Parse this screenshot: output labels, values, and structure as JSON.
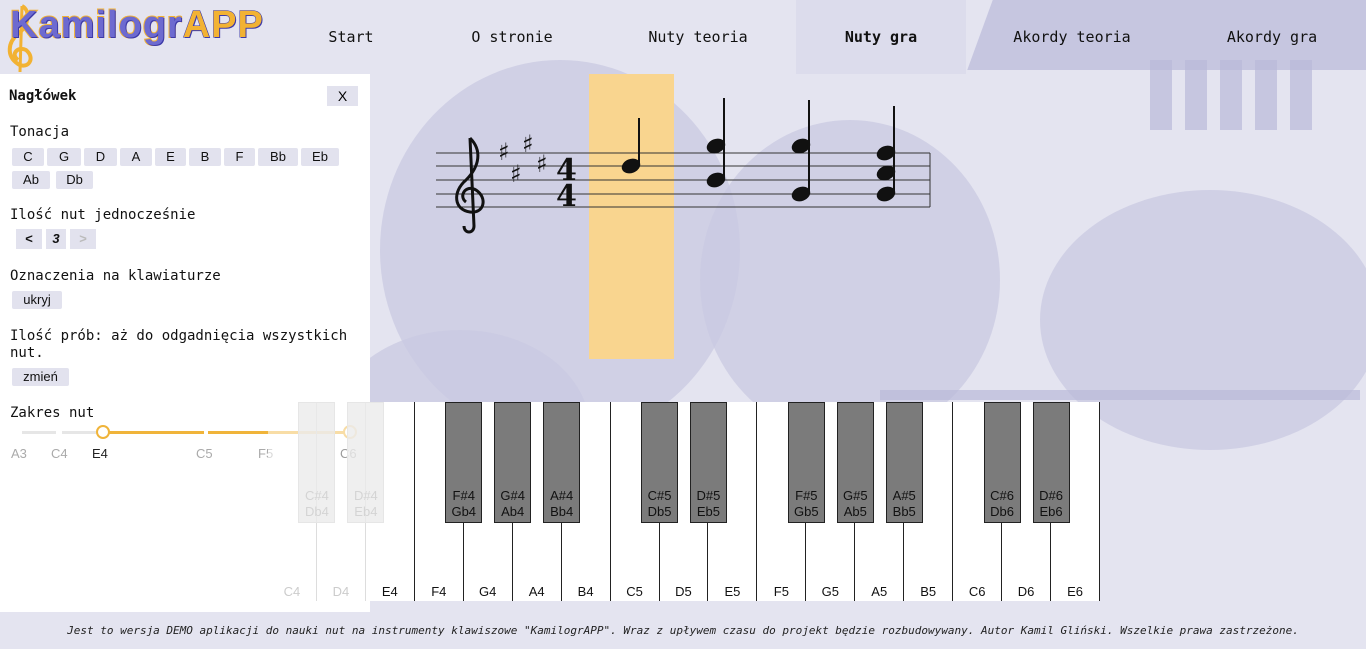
{
  "app": {
    "logo_text": "KamilogrAPP",
    "logo_main": "Kamilogr",
    "logo_suffix": "APP"
  },
  "nav": {
    "items": [
      "Start",
      "O stronie",
      "Nuty teoria",
      "Nuty gra",
      "Akordy teoria",
      "Akordy gra"
    ],
    "active": "Nuty gra"
  },
  "panel": {
    "title": "Nagłówek",
    "close_label": "X",
    "key": {
      "label": "Tonacja",
      "options": [
        "C",
        "G",
        "D",
        "A",
        "E",
        "B",
        "F",
        "Bb",
        "Eb",
        "Ab",
        "Db"
      ]
    },
    "simultaneous": {
      "label": "Ilość nut jednocześnie",
      "prev": "<",
      "value": "3",
      "next": ">"
    },
    "markings": {
      "label": "Oznaczenia na klawiaturze",
      "button": "ukryj"
    },
    "attempts": {
      "label": "Ilość prób: aż do odgadnięcia wszystkich nut.",
      "button": "zmień"
    },
    "range": {
      "label": "Zakres nut",
      "ticks": [
        "A3",
        "C4",
        "E4",
        "C5",
        "F5",
        "C6"
      ],
      "from": "E4",
      "to": "C6"
    }
  },
  "staff": {
    "clef": "treble",
    "key_signature": "4 sharps",
    "time_signature": "4/4"
  },
  "keyboard": {
    "white_keys": [
      "C4",
      "D4",
      "E4",
      "F4",
      "G4",
      "A4",
      "B4",
      "C5",
      "D5",
      "E5",
      "F5",
      "G5",
      "A5",
      "B5",
      "C6",
      "D6",
      "E6"
    ],
    "black_keys": [
      {
        "sharp": "C#4",
        "flat": "Db4"
      },
      {
        "sharp": "D#4",
        "flat": "Eb4"
      },
      {
        "sharp": "F#4",
        "flat": "Gb4"
      },
      {
        "sharp": "G#4",
        "flat": "Ab4"
      },
      {
        "sharp": "A#4",
        "flat": "Bb4"
      },
      {
        "sharp": "C#5",
        "flat": "Db5"
      },
      {
        "sharp": "D#5",
        "flat": "Eb5"
      },
      {
        "sharp": "F#5",
        "flat": "Gb5"
      },
      {
        "sharp": "G#5",
        "flat": "Ab5"
      },
      {
        "sharp": "A#5",
        "flat": "Bb5"
      },
      {
        "sharp": "C#6",
        "flat": "Db6"
      },
      {
        "sharp": "D#6",
        "flat": "Eb6"
      }
    ],
    "disabled_keys": [
      "C4",
      "D4",
      "C#4",
      "D#4"
    ]
  },
  "footer": "Jest to wersja DEMO aplikacji do nauki nut na instrumenty klawiszowe \"KamilogrAPP\". Wraz z upływem czasu do projekt będzie rozbudowywany. Autor Kamil Gliński. Wszelkie prawa zastrzeżone."
}
